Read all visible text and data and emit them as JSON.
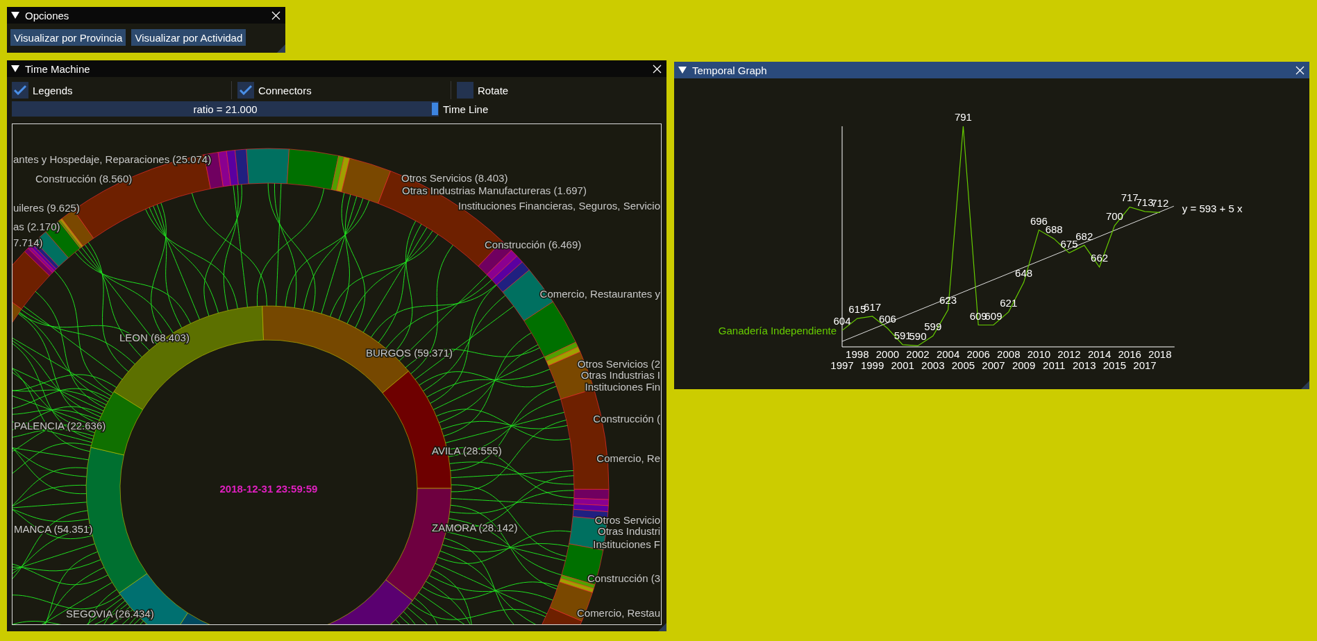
{
  "options_window": {
    "title": "Opciones",
    "active": false,
    "buttons": [
      "Visualizar por Provincia",
      "Visualizar por Actividad"
    ]
  },
  "time_machine": {
    "title": "Time Machine",
    "active": false,
    "checkboxes": [
      {
        "label": "Legends",
        "checked": true
      },
      {
        "label": "Connectors",
        "checked": true
      },
      {
        "label": "Rotate",
        "checked": false
      }
    ],
    "slider": {
      "text": "ratio = 21.000",
      "level": 1,
      "label": "Time Line"
    },
    "diagram": {
      "timestamp": "2018-12-31 23:59:59",
      "province_labels": [
        "LEON (68.403)",
        "BURGOS (59.371)",
        "PALENCIA (22.636)",
        "AVILA (28.555)",
        "MANCA (54.351)",
        "ZAMORA (28.142)",
        "SEGOVIA (26.434)"
      ],
      "activity_labels": [
        "antes y Hospedaje, Reparaciones (25.074)",
        "Construcción (8.560)",
        "uileres (9.625)",
        "as (2.170)",
        "7.714)",
        "Otros Servicios (8.403)",
        "Otras Industrias Manufactureras (1.697)",
        "Instituciones Financieras, Seguros, Servicio",
        "Construcción (6.469)",
        "Comercio, Restaurantes y",
        "Otros Servicios (2",
        "Otras Industrias I",
        "Instituciones Fin",
        "Construcción (",
        "Comercio, Re",
        "Otros Servicio",
        "Otras Industri",
        "Instituciones F",
        "Construcción (3",
        "Comercio, Restau"
      ]
    }
  },
  "temporal_graph": {
    "title": "Temporal Graph",
    "active": true,
    "chart_data": {
      "type": "line",
      "categories": [
        "1997",
        "1998",
        "1999",
        "2000",
        "2001",
        "2002",
        "2003",
        "2004",
        "2005",
        "2006",
        "2007",
        "2008",
        "2009",
        "2010",
        "2011",
        "2012",
        "2013",
        "2014",
        "2015",
        "2016",
        "2017",
        "2018"
      ],
      "series": [
        {
          "name": "Ganadería Independiente",
          "color": "#66cc00",
          "values": [
            604,
            615,
            617,
            606,
            591,
            590,
            599,
            623,
            791,
            609,
            609,
            621,
            648,
            696,
            688,
            675,
            682,
            662,
            700,
            717,
            713,
            712
          ]
        }
      ],
      "ylim": [
        589,
        791
      ],
      "data_labels": true,
      "annotations": [
        "y = 593 + 5 x"
      ]
    }
  }
}
